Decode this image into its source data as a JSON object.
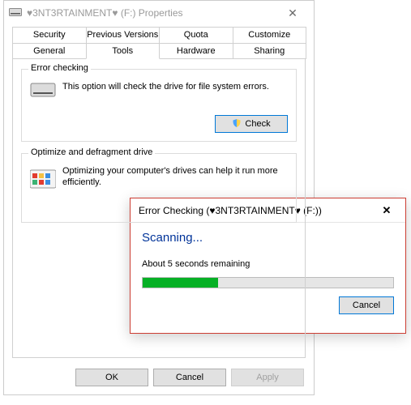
{
  "window": {
    "title": "♥3NT3RTAINMENT♥ (F:) Properties"
  },
  "tabs": {
    "row1": [
      "Security",
      "Previous Versions",
      "Quota",
      "Customize"
    ],
    "row2": [
      "General",
      "Tools",
      "Hardware",
      "Sharing"
    ],
    "active": "Tools"
  },
  "group_error": {
    "legend": "Error checking",
    "text": "This option will check the drive for file system errors.",
    "button": "Check"
  },
  "group_defrag": {
    "legend": "Optimize and defragment drive",
    "text": "Optimizing your computer's drives can help it run more efficiently."
  },
  "bottom": {
    "ok": "OK",
    "cancel": "Cancel",
    "apply": "Apply"
  },
  "modal": {
    "title": "Error Checking (♥3NT3RTAINMENT♥ (F:))",
    "status": "Scanning...",
    "remaining": "About 5 seconds remaining",
    "progress_percent": 30,
    "cancel": "Cancel"
  }
}
